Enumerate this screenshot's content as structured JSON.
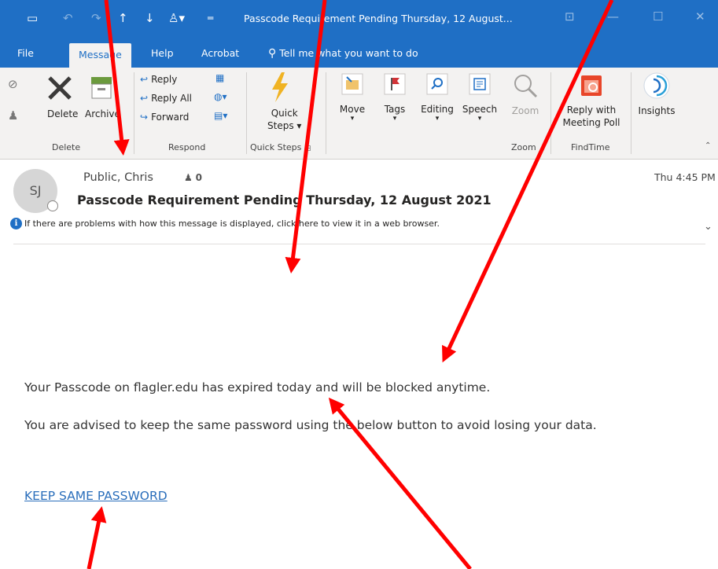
{
  "window": {
    "title": "Passcode Requirement Pending Thursday, 12 August...",
    "accent": "#1f6fc5"
  },
  "quick_access": [
    {
      "icon": "save-icon",
      "glyph": "🖫"
    },
    {
      "icon": "undo-icon",
      "glyph": "↶"
    },
    {
      "icon": "redo-icon",
      "glyph": "↷"
    },
    {
      "icon": "up-arrow-icon",
      "glyph": "↑"
    },
    {
      "icon": "down-arrow-icon",
      "glyph": "↓"
    },
    {
      "icon": "rules-icon",
      "glyph": "⚲"
    },
    {
      "icon": "customize-icon",
      "glyph": "▾"
    }
  ],
  "tabs": {
    "file": "File",
    "message": "Message",
    "help": "Help",
    "acrobat": "Acrobat",
    "tell_me": "Tell me what you want to do"
  },
  "ribbon": {
    "delete_group": {
      "label": "Delete",
      "delete": "Delete",
      "archive": "Archive"
    },
    "respond_group": {
      "label": "Respond",
      "reply": "Reply",
      "reply_all": "Reply All",
      "forward": "Forward"
    },
    "quick_steps_group": {
      "label": "Quick Steps",
      "quick_steps_1": "Quick",
      "quick_steps_2": "Steps"
    },
    "move": "Move",
    "tags": "Tags",
    "editing": "Editing",
    "speech": "Speech",
    "zoom": "Zoom",
    "zoom_group_label": "Zoom",
    "reply_with_1": "Reply with",
    "reply_with_2": "Meeting Poll",
    "findtime_group_label": "FindTime",
    "insights": "Insights"
  },
  "message": {
    "avatar_initials": "SJ",
    "sender": "Public, Chris",
    "people_count": "0",
    "timestamp": "Thu 4:45 PM",
    "subject": "Passcode Requirement Pending Thursday, 12 August 2021",
    "info_bar": "If there are problems with how this message is displayed, click here to view it in a web browser."
  },
  "body": {
    "line1": "Your Passcode on flagler.edu has expired today and will be blocked anytime.",
    "line2": "You are advised to keep the same password using the below button to avoid losing your data.",
    "link": "KEEP SAME PASSWORD",
    "link_color": "#2a6ebb"
  },
  "annotation_color": "#ff0000"
}
